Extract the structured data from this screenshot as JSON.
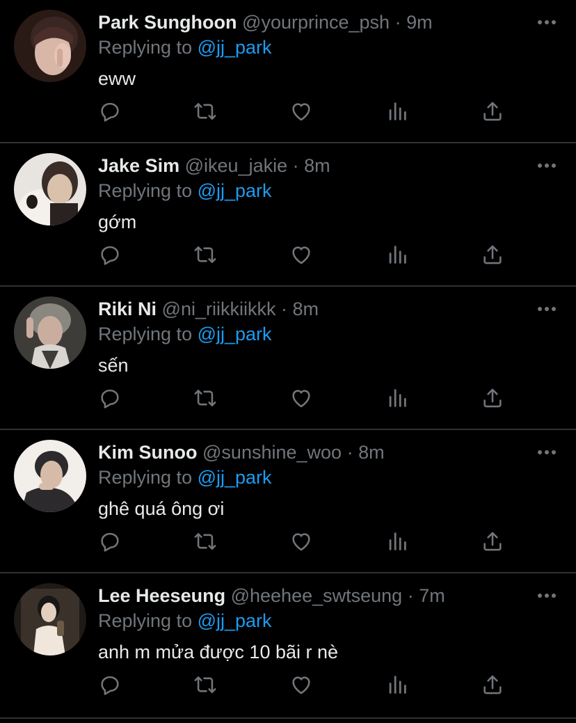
{
  "tweets": [
    {
      "name": "Park Sunghoon",
      "handle": "@yourprince_psh",
      "separator": "·",
      "time": "9m",
      "replying_prefix": "Replying to ",
      "replying_to": "@jj_park",
      "text": "eww",
      "avatar_colors": [
        "#2a1a16",
        "#d8b6a8",
        "#4a2e2a"
      ]
    },
    {
      "name": "Jake Sim",
      "handle": "@ikeu_jakie",
      "separator": "·",
      "time": "8m",
      "replying_prefix": "Replying to ",
      "replying_to": "@jj_park",
      "text": "gớm",
      "avatar_colors": [
        "#e8e4e0",
        "#d9c1ac",
        "#3a2d28"
      ]
    },
    {
      "name": "Riki Ni",
      "handle": "@ni_riikkiikkk",
      "separator": "·",
      "time": "8m",
      "replying_prefix": "Replying to ",
      "replying_to": "@jj_park",
      "text": "sến",
      "avatar_colors": [
        "#3e3c38",
        "#c9aea0",
        "#8a8680"
      ]
    },
    {
      "name": "Kim Sunoo",
      "handle": "@sunshine_woo",
      "separator": "·",
      "time": "8m",
      "replying_prefix": "Replying to ",
      "replying_to": "@jj_park",
      "text": "ghê quá ông ơi",
      "avatar_colors": [
        "#f2eeea",
        "#d6bca8",
        "#2c2a2c"
      ]
    },
    {
      "name": "Lee Heeseung",
      "handle": "@heehee_swtseung",
      "separator": "·",
      "time": "7m",
      "replying_prefix": "Replying to ",
      "replying_to": "@jj_park",
      "text": "anh m mửa được 10 bãi r nè",
      "avatar_colors": [
        "#1e1a16",
        "#e2cfc0",
        "#6c5a48"
      ]
    }
  ],
  "icons": {
    "more": "more-horizontal-icon",
    "reply": "reply-icon",
    "retweet": "retweet-icon",
    "like": "heart-icon",
    "stats": "analytics-icon",
    "share": "share-icon"
  },
  "colors": {
    "background": "#000000",
    "text": "#e7e9ea",
    "muted": "#71767b",
    "mention": "#1d9bf0",
    "divider": "#2f3336"
  }
}
